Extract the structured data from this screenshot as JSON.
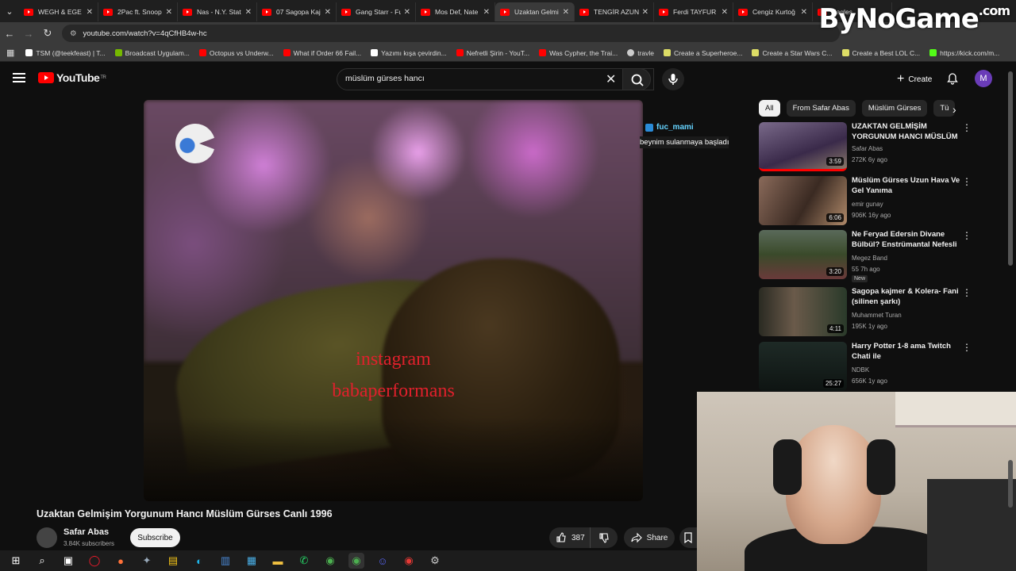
{
  "browser": {
    "tabs": [
      {
        "title": "WEGH & EGE"
      },
      {
        "title": "2Pac ft. Snoop"
      },
      {
        "title": "Nas - N.Y. Stat"
      },
      {
        "title": "07 Sagopa Kaj"
      },
      {
        "title": "Gang Starr - Fu"
      },
      {
        "title": "Mos Def, Nate"
      },
      {
        "title": "Uzaktan Gelmi"
      },
      {
        "title": "TENGİR AZUN"
      },
      {
        "title": "Ferdi TAYFUR -"
      },
      {
        "title": "Cengiz Kurtoğ"
      },
      {
        "title": "Eagles"
      }
    ],
    "active_tab_index": 6,
    "url": "youtube.com/watch?v=4qCfHB4w-hc",
    "bookmarks": [
      {
        "label": "TSM (@teekfeast) | T...",
        "color": "#ffffff"
      },
      {
        "label": "Broadcast Uygulam...",
        "color": "#76b900"
      },
      {
        "label": "Octopus vs Underw...",
        "color": "#ff0000"
      },
      {
        "label": "What if Order 66 Fail...",
        "color": "#ff0000"
      },
      {
        "label": "Yazımı kışa çevirdin...",
        "color": "#ffffff"
      },
      {
        "label": "Nefretli Şirin - YouT...",
        "color": "#ff0000"
      },
      {
        "label": "Was Cypher, the Trai...",
        "color": "#ff0000"
      },
      {
        "label": "travle",
        "color": "#cccccc"
      },
      {
        "label": "Create a Superheroe...",
        "color": "#dddd66"
      },
      {
        "label": "Create a Star Wars C...",
        "color": "#dddd66"
      },
      {
        "label": "Create a Best LOL C...",
        "color": "#dddd66"
      },
      {
        "label": "https://kick.com/m...",
        "color": "#53fc18"
      }
    ]
  },
  "watermark": {
    "text": "ByNoGame",
    "suffix": ".com"
  },
  "youtube": {
    "logo_text": "YouTube",
    "country_code": "TR",
    "search_value": "müslüm gürses hancı",
    "create_label": "Create",
    "avatar_letter": "M"
  },
  "video": {
    "overlay_line1": "instagram",
    "overlay_line2": "babaperformans",
    "chat_user": "fuc_mami",
    "chat_message": "beynim sulanmaya başladı",
    "title": "Uzaktan Gelmişim Yorgunum Hancı Müslüm Gürses Canlı 1996",
    "channel": "Safar Abas",
    "subscribers": "3.84K subscribers",
    "subscribe_label": "Subscribe",
    "likes": "387",
    "share_label": "Share"
  },
  "chips": [
    "All",
    "From Safar Abas",
    "Müslüm Gürses",
    "Tü"
  ],
  "recommendations": [
    {
      "title": "UZAKTAN GELMİŞİM YORGUNUM HANCI MÜSLÜM ...",
      "channel": "Safar Abas",
      "meta": "272K  6y ago",
      "duration": "3:59",
      "thumb_color": "#6a5a7a"
    },
    {
      "title": "Müslüm Gürses Uzun Hava Ve Gel Yanıma",
      "channel": "emir gunay",
      "meta": "906K  16y ago",
      "duration": "6:06",
      "thumb_color": "#6b4a3a"
    },
    {
      "title": "Ne Feryad Edersin Divane Bülbül? Enstrümantal Nefesli ...",
      "channel": "Megez Band",
      "meta": "55  7h ago",
      "duration": "3:20",
      "thumb_color": "#4a5a3a",
      "badge": "New"
    },
    {
      "title": "Sagopa kajmer & Kolera- Fani (silinen şarkı)",
      "channel": "Muhammet Turan",
      "meta": "195K  1y ago",
      "duration": "4:11",
      "thumb_color": "#3a4a3a"
    },
    {
      "title": "Harry Potter 1-8 ama Twitch Chati ile",
      "channel": "NDBK",
      "meta": "656K  1y ago",
      "duration": "25:27",
      "thumb_color": "#1e2a26"
    }
  ]
}
